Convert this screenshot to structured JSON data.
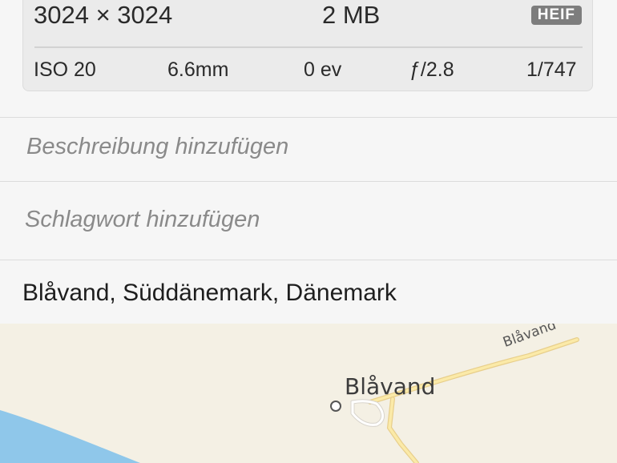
{
  "exif": {
    "dimensions": "3024 × 3024",
    "file_size": "2 MB",
    "format_badge": "HEIF",
    "iso": "ISO 20",
    "focal_length": "6.6mm",
    "exposure_bias": "0 ev",
    "aperture": "ƒ/2.8",
    "shutter": "1/747"
  },
  "description": {
    "placeholder": "Beschreibung hinzufügen"
  },
  "keyword": {
    "placeholder": "Schlagwort hinzufügen"
  },
  "location": {
    "text": "Blåvand, Süddänemark, Dänemark"
  },
  "map": {
    "town_label": "Blåvand",
    "road_label": "Blåvand",
    "colors": {
      "land": "#f4f0e4",
      "water": "#8fc7ea",
      "road": "#f2d58a"
    }
  }
}
